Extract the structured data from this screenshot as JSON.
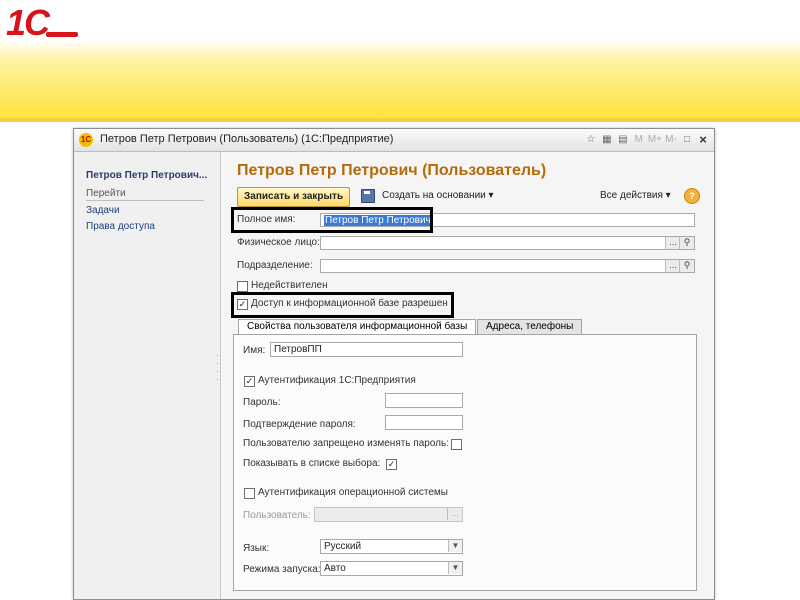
{
  "slide": {
    "logo": "1С"
  },
  "window": {
    "title": "Петров Петр Петрович (Пользователь) (1С:Предприятие)",
    "controls": [
      "M",
      "M+",
      "M-",
      "□",
      "×"
    ]
  },
  "sidebar": {
    "user": "Петров Петр Петрович...",
    "section": "Перейти",
    "links": [
      "Задачи",
      "Права доступа"
    ]
  },
  "form": {
    "title": "Петров Петр Петрович (Пользователь)",
    "toolbar": {
      "save_close": "Записать и закрыть",
      "create_based_on": "Создать на основании ▾",
      "all_actions": "Все действия ▾",
      "help": "?"
    },
    "full_name": {
      "label": "Полное имя:",
      "value": "Петров Петр Петрович"
    },
    "individual": {
      "label": "Физическое лицо:",
      "value": ""
    },
    "department": {
      "label": "Подразделение:",
      "value": ""
    },
    "invalid": {
      "label": "Недействителен",
      "checked": false
    },
    "ib_access": {
      "label": "Доступ к информационной базе разрешен",
      "checked": true
    },
    "tabs": [
      "Свойства пользователя информационной базы",
      "Адреса, телефоны"
    ],
    "props": {
      "name_label": "Имя:",
      "name_value": "ПетровПП",
      "auth_1c": "Аутентификация 1С:Предприятия",
      "password": "Пароль:",
      "confirm_password": "Подтверждение пароля:",
      "forbid_change": "Пользователю запрещено изменять пароль:",
      "show_in_list": "Показывать в списке выбора:",
      "auth_os": "Аутентификация операционной системы",
      "os_user": "Пользователь:",
      "language_label": "Язык:",
      "language_value": "Русский",
      "mode_label": "Режима запуска:",
      "mode_value": "Авто"
    }
  }
}
